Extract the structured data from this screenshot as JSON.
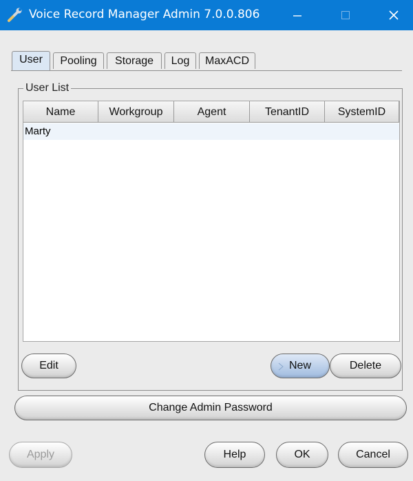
{
  "window": {
    "title": "Voice Record Manager Admin 7.0.0.806",
    "titlebar_color": "#0a7bd6",
    "app_icon": "wrench-icon"
  },
  "tabs": [
    {
      "label": "User",
      "active": true
    },
    {
      "label": "Pooling",
      "active": false
    },
    {
      "label": "Storage",
      "active": false
    },
    {
      "label": "Log",
      "active": false
    },
    {
      "label": "MaxACD",
      "active": false
    }
  ],
  "user_list": {
    "title": "User List",
    "columns": [
      "Name",
      "Workgroup",
      "Agent",
      "TenantID",
      "SystemID"
    ],
    "rows": [
      {
        "name": "Marty",
        "workgroup": "",
        "agent": "",
        "tenantid": "",
        "systemid": ""
      }
    ]
  },
  "buttons": {
    "edit": "Edit",
    "new": "New",
    "delete": "Delete",
    "change_password": "Change Admin Password",
    "apply": "Apply",
    "help": "Help",
    "ok": "OK",
    "cancel": "Cancel"
  }
}
